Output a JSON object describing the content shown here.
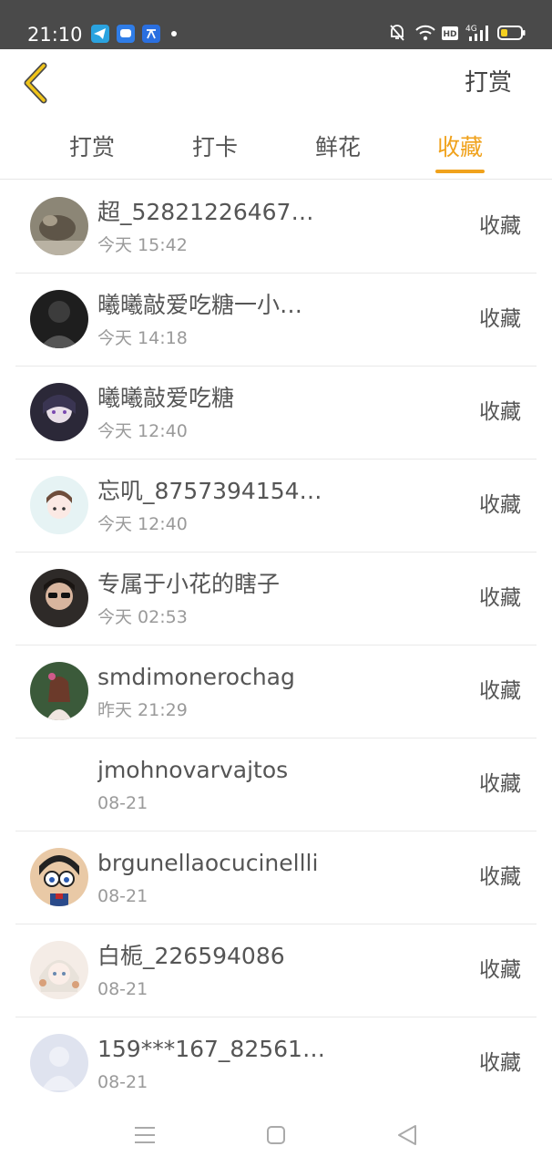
{
  "status_bar": {
    "time": "21:10",
    "icons": [
      "telegram-icon",
      "message-icon",
      "translate-icon",
      "notification-dot",
      "mute-icon",
      "wifi-icon",
      "hd-icon",
      "signal-4g-icon",
      "battery-icon"
    ]
  },
  "header": {
    "back_icon": "chevron-left-icon",
    "action_label": "打赏"
  },
  "tabs": [
    {
      "label": "打赏",
      "active": false
    },
    {
      "label": "打卡",
      "active": false
    },
    {
      "label": "鲜花",
      "active": false
    },
    {
      "label": "收藏",
      "active": true
    }
  ],
  "colors": {
    "accent": "#f0a21c",
    "status_bar": "#4a4a4a",
    "text_primary": "#555555",
    "text_secondary": "#9a9a9a"
  },
  "items": [
    {
      "name": "超_52821226467…",
      "time": "今天 15:42",
      "action": "收藏",
      "avatar": "photo"
    },
    {
      "name": "曦曦敲爱吃糖一小…",
      "time": "今天 14:18",
      "action": "收藏",
      "avatar": "photo"
    },
    {
      "name": "曦曦敲爱吃糖",
      "time": "今天 12:40",
      "action": "收藏",
      "avatar": "anime"
    },
    {
      "name": "忘叽_8757394154…",
      "time": "今天 12:40",
      "action": "收藏",
      "avatar": "anime"
    },
    {
      "name": "专属于小花的瞎子",
      "time": "今天 02:53",
      "action": "收藏",
      "avatar": "photo"
    },
    {
      "name": "smdimonerochag",
      "time": "昨天 21:29",
      "action": "收藏",
      "avatar": "photo"
    },
    {
      "name": "jmohnovarvajtos",
      "time": "08-21",
      "action": "收藏",
      "avatar": "none"
    },
    {
      "name": "brgunellaocucinellli",
      "time": "08-21",
      "action": "收藏",
      "avatar": "cartoon"
    },
    {
      "name": "白栀_226594086",
      "time": "08-21",
      "action": "收藏",
      "avatar": "anime"
    },
    {
      "name": "159***167_82561…",
      "time": "08-21",
      "action": "收藏",
      "avatar": "default"
    }
  ],
  "navbar": {
    "icons": [
      "menu-icon",
      "home-square-icon",
      "back-triangle-icon"
    ]
  }
}
